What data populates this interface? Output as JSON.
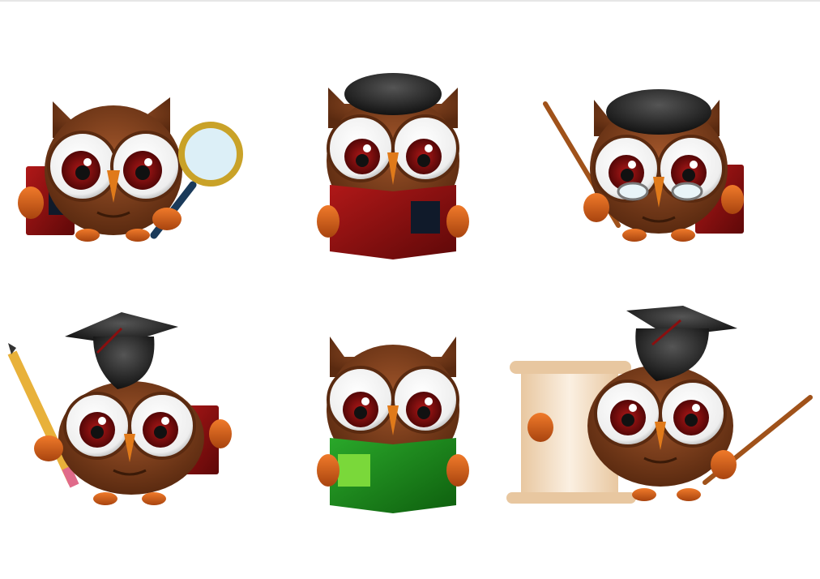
{
  "image": {
    "subject": "six-cartoon-owls",
    "background_color": "#ffffff",
    "colors": {
      "owl_body": "#7a3f1d",
      "owl_body_dark": "#4a2410",
      "eye_white": "#ffffff",
      "iris": "#7a0f0f",
      "beak": "#e07a1a",
      "feet": "#d9611a",
      "red_book": "#8a0f0f",
      "green_book": "#1f8a1f",
      "cap_black": "#1a1a1a",
      "scroll": "#f3dcc0",
      "stick": "#a0521a",
      "pencil": "#e8b13a"
    },
    "owls": [
      {
        "name": "owl-magnifying-glass",
        "props": [
          "magnifying-glass",
          "red-book"
        ]
      },
      {
        "name": "owl-reading-red-book",
        "props": [
          "black-hair",
          "red-book"
        ]
      },
      {
        "name": "owl-teacher-glasses",
        "props": [
          "black-hair",
          "glasses",
          "pointer",
          "red-book"
        ]
      },
      {
        "name": "owl-graduate-pencil",
        "props": [
          "mortarboard",
          "pencil",
          "red-book"
        ]
      },
      {
        "name": "owl-reading-green-book",
        "props": [
          "green-book"
        ]
      },
      {
        "name": "owl-graduate-scroll",
        "props": [
          "mortarboard",
          "scroll",
          "pointer"
        ]
      }
    ]
  }
}
